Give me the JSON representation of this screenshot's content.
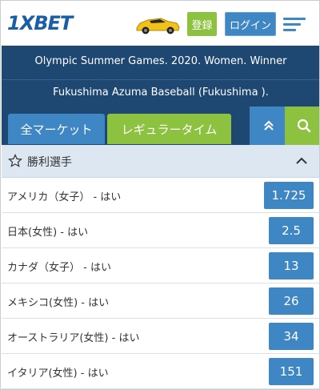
{
  "header": {
    "logo": "1XBET",
    "register_label": "登録",
    "login_label": "ログイン"
  },
  "event": {
    "title": "Olympic Summer Games. 2020. Women. Winner",
    "venue": "Fukushima Azuma Baseball (Fukushima )."
  },
  "tabs": {
    "all_markets": "全マーケット",
    "regular_time": "レギュラータイム"
  },
  "market": {
    "title": "勝利選手",
    "rows": [
      {
        "label": "アメリカ（女子） - はい",
        "odds": "1.725"
      },
      {
        "label": "日本(女性) - はい",
        "odds": "2.5"
      },
      {
        "label": "カナダ（女子） - はい",
        "odds": "13"
      },
      {
        "label": "メキシコ(女性) - はい",
        "odds": "26"
      },
      {
        "label": "オーストラリア(女性) - はい",
        "odds": "34"
      },
      {
        "label": "イタリア(女性) - はい",
        "odds": "151"
      }
    ]
  },
  "colors": {
    "brand_blue": "#3f86c4",
    "brand_green": "#8cc23f",
    "navy": "#1e4772"
  }
}
